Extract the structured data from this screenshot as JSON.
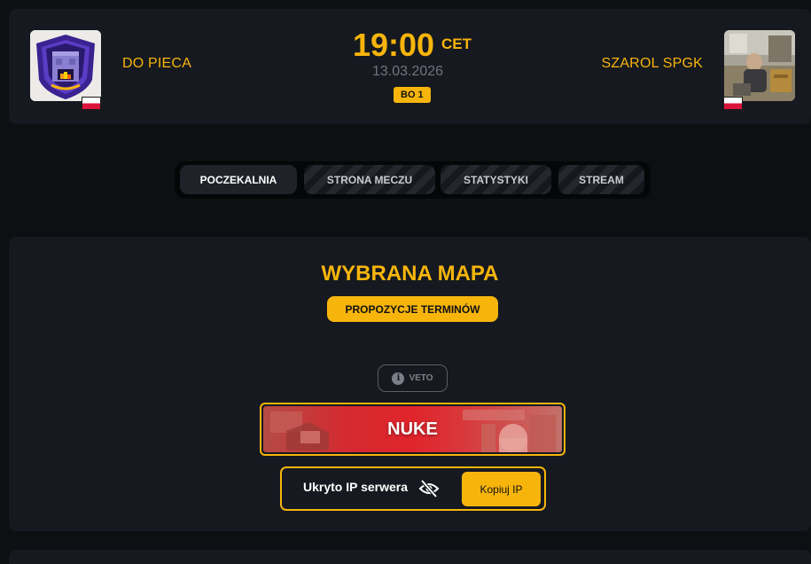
{
  "match": {
    "team_left": {
      "name": "DO PIECA",
      "flag": "poland-flag"
    },
    "team_right": {
      "name": "SZAROL SPGK",
      "flag": "poland-flag"
    },
    "time": "19:00",
    "timezone": "CET",
    "date": "13.03.2026",
    "format": "BO 1"
  },
  "tabs": [
    {
      "label": "POCZEKALNIA",
      "active": true
    },
    {
      "label": "STRONA MECZU",
      "active": false
    },
    {
      "label": "STATYSTYKI",
      "active": false
    },
    {
      "label": "STREAM",
      "active": false
    }
  ],
  "map_section": {
    "title": "WYBRANA MAPA",
    "propose_button": "PROPOZYCJE TERMINÓW",
    "veto_button": "VETO",
    "veto_icon": "info-icon",
    "map_name": "NUKE"
  },
  "server": {
    "ip_label": "Ukryto IP serwera",
    "ip_icon": "eye-slash-icon",
    "copy_button": "Kopiuj IP"
  },
  "colors": {
    "accent": "#f7b50c",
    "background": "#0d0f13",
    "card": "#16191f",
    "muted": "#70747c"
  }
}
